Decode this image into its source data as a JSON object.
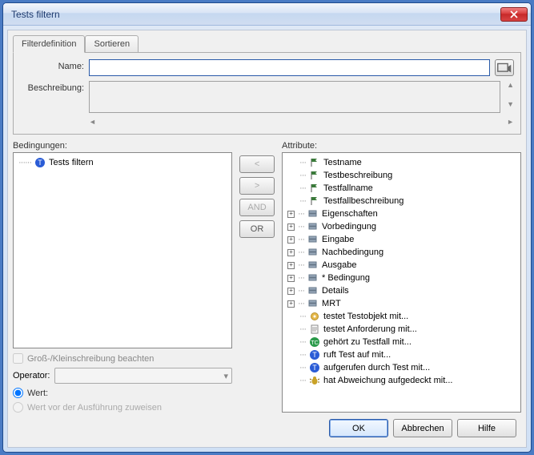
{
  "window": {
    "title": "Tests filtern"
  },
  "tabs": {
    "definition": "Filterdefinition",
    "sort": "Sortieren"
  },
  "form": {
    "name_label": "Name:",
    "desc_label": "Beschreibung:",
    "left_arrow": "◄",
    "right_arrow": "►"
  },
  "panels": {
    "conditions": "Bedingungen:",
    "attributes": "Attribute:"
  },
  "conditions_tree": {
    "root": "Tests filtern"
  },
  "ops": {
    "lt": "<",
    "gt": ">",
    "and": "AND",
    "or": "OR"
  },
  "options": {
    "case_label": "Groß-/Kleinschreibung beachten",
    "operator_label": "Operator:",
    "wert_label": "Wert:",
    "wert_vor_label": "Wert vor der Ausführung zuweisen"
  },
  "attributes": [
    {
      "exp": "",
      "icon": "flag",
      "label": "Testname"
    },
    {
      "exp": "",
      "icon": "flag",
      "label": "Testbeschreibung"
    },
    {
      "exp": "",
      "icon": "flag",
      "label": "Testfallname"
    },
    {
      "exp": "",
      "icon": "flag",
      "label": "Testfallbeschreibung"
    },
    {
      "exp": "+",
      "icon": "stack",
      "label": "Eigenschaften"
    },
    {
      "exp": "+",
      "icon": "stack",
      "label": "Vorbedingung"
    },
    {
      "exp": "+",
      "icon": "stack",
      "label": "Eingabe"
    },
    {
      "exp": "+",
      "icon": "stack",
      "label": "Nachbedingung"
    },
    {
      "exp": "+",
      "icon": "stack",
      "label": "Ausgabe"
    },
    {
      "exp": "+",
      "icon": "stack",
      "label": "* Bedingung"
    },
    {
      "exp": "+",
      "icon": "stack",
      "label": "Details"
    },
    {
      "exp": "+",
      "icon": "stack",
      "label": "MRT"
    },
    {
      "exp": "",
      "icon": "gear",
      "label": "testet Testobjekt mit..."
    },
    {
      "exp": "",
      "icon": "doc",
      "label": "testet Anforderung mit..."
    },
    {
      "exp": "",
      "icon": "tc",
      "label": "gehört zu Testfall mit..."
    },
    {
      "exp": "",
      "icon": "t",
      "label": "ruft Test auf mit..."
    },
    {
      "exp": "",
      "icon": "t",
      "label": "aufgerufen durch Test mit..."
    },
    {
      "exp": "",
      "icon": "bug",
      "label": "hat Abweichung aufgedeckt mit..."
    }
  ],
  "buttons": {
    "ok": "OK",
    "cancel": "Abbrechen",
    "help": "Hilfe"
  }
}
